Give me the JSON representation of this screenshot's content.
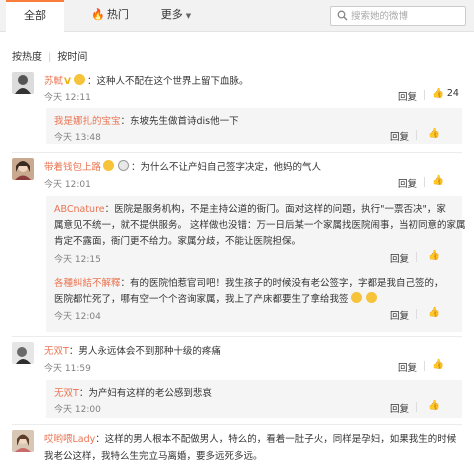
{
  "tabs": {
    "all": "全部",
    "hot": "热门",
    "more": "更多"
  },
  "search": {
    "placeholder": "搜索她的微博"
  },
  "sort": {
    "by_hot": "按热度",
    "by_time": "按时间"
  },
  "actions": {
    "reply": "回复",
    "like_icon": "thumbs-up-icon"
  },
  "comments": [
    {
      "user": "苏軾",
      "text": "：这种人不配在这个世界上留下血脉。",
      "time": "今天 12:11",
      "likes": "24",
      "replies": [
        {
          "user": "我是娜扎的宝宝",
          "text": "：东坡先生做首诗dis他一下",
          "time": "今天 13:48"
        }
      ]
    },
    {
      "user": "带着钱包上路",
      "text": "：为什么不让产妇自己签字决定，他妈的气人",
      "time": "今天 12:01",
      "likes": "",
      "replies": [
        {
          "user": "ABCnature",
          "lines": [
            "：医院是服务机构，不是主持公道的衙门。面对这样的问题，执行\"一票否决\"，家",
            "属意见不统一，就不提供服务。 这样做也没错：万一日后某一个家属找医院闹事，当初同意的家属",
            "肯定不露面，衙门更不给力。家属分歧，不能让医院担保。"
          ],
          "time": "今天 12:15"
        },
        {
          "user": "各種糾結不解釋",
          "lines": [
            "：有的医院怕惹官司吧！我生孩子的时候没有老公签字，字都是我自己签的，",
            "医院都忙死了，哪有空一个个咨询家属，我上了产床都要生了拿给我签"
          ],
          "time": "今天 12:04"
        }
      ]
    },
    {
      "user": "无双T",
      "text": "：男人永远体会不到那种十级的疼痛",
      "time": "今天 11:59",
      "likes": "",
      "replies": [
        {
          "user": "无双T",
          "text": "：为产妇有这样的老公感到悲哀",
          "time": "今天 12:00"
        }
      ]
    },
    {
      "user": "哎哟喂Lady",
      "lines": [
        "：这样的男人根本不配做男人，特么的，看着一肚子火，同样是孕妇，如果我生的时候",
        "我老公这样，我特么生完立马离婚，要多远死多远。"
      ]
    }
  ]
}
